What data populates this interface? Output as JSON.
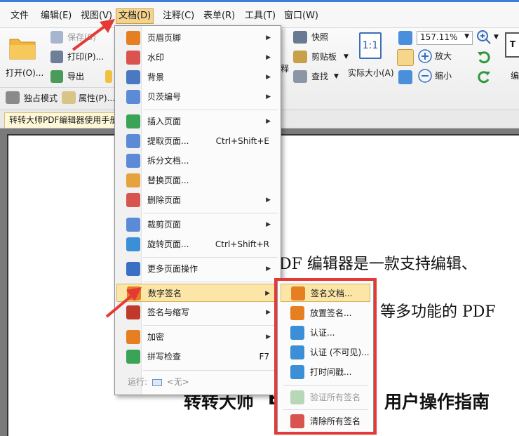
{
  "menubar": {
    "items": [
      {
        "label": "文件"
      },
      {
        "label": "编辑(E)"
      },
      {
        "label": "视图(V)"
      },
      {
        "label": "文档(D)"
      },
      {
        "label": "注释(C)"
      },
      {
        "label": "表单(R)"
      },
      {
        "label": "工具(T)"
      },
      {
        "label": "窗口(W)"
      }
    ]
  },
  "ribbon": {
    "open_label": "打开(O)...",
    "save_label": "保存(S)",
    "print_label": "打印(P)...",
    "export_label": "导出",
    "exclusive_mode_label": "独占模式",
    "properties_label": "属性(P)...",
    "partial_label": "释",
    "snapshot_label": "快照",
    "clipboard_label": "剪贴板",
    "find_label": "查找",
    "actual_size_label": "实际大小(A)",
    "zoom_value": "157.11%",
    "zoom_in_label": "放大",
    "zoom_out_label": "缩小",
    "edge_label": "编"
  },
  "tabs": {
    "document_tab": "转转大师PDF编辑器使用手册"
  },
  "document": {
    "line1": "DF 编辑器是一款支持编辑、",
    "line2": "等多功能的 PDF",
    "title": "转转大师",
    "title_mid": "E",
    "title_end": "用户操作指南"
  },
  "doc_menu": {
    "items": [
      {
        "label": "页眉页脚",
        "shortcut": "",
        "submenu": true,
        "color": "#e67e22"
      },
      {
        "label": "水印",
        "shortcut": "",
        "submenu": true,
        "color": "#d9534f"
      },
      {
        "label": "背景",
        "shortcut": "",
        "submenu": true,
        "color": "#4a78c2"
      },
      {
        "label": "贝茨编号",
        "shortcut": "",
        "submenu": true,
        "color": "#5b8bd6"
      },
      {
        "label": "插入页面",
        "shortcut": "",
        "submenu": true,
        "color": "#3aa356"
      },
      {
        "label": "提取页面...",
        "shortcut": "Ctrl+Shift+E",
        "submenu": false,
        "color": "#5b8bd6"
      },
      {
        "label": "拆分文档...",
        "shortcut": "",
        "submenu": false,
        "color": "#5b8bd6"
      },
      {
        "label": "替换页面...",
        "shortcut": "",
        "submenu": false,
        "color": "#e6a23c"
      },
      {
        "label": "删除页面",
        "shortcut": "",
        "submenu": true,
        "color": "#d9534f"
      },
      {
        "label": "裁剪页面",
        "shortcut": "",
        "submenu": true,
        "color": "#5b8bd6"
      },
      {
        "label": "旋转页面...",
        "shortcut": "Ctrl+Shift+R",
        "submenu": false,
        "color": "#3a8fd6"
      },
      {
        "label": "更多页面操作",
        "shortcut": "",
        "submenu": true,
        "color": "#3a6fc4"
      },
      {
        "label": "数字签名",
        "shortcut": "",
        "submenu": true,
        "color": "#e67e22"
      },
      {
        "label": "签名与缩写",
        "shortcut": "",
        "submenu": true,
        "color": "#c0392b"
      },
      {
        "label": "加密",
        "shortcut": "",
        "submenu": true,
        "color": "#e67e22"
      },
      {
        "label": "拼写检查",
        "shortcut": "F7",
        "submenu": false,
        "color": "#3aa356"
      }
    ],
    "run_label": "运行:",
    "run_value": "<无>"
  },
  "signature_submenu": {
    "items": [
      {
        "label": "签名文档...",
        "disabled": false,
        "color": "#e67e22"
      },
      {
        "label": "放置签名...",
        "disabled": false,
        "color": "#e67e22"
      },
      {
        "label": "认证...",
        "disabled": false,
        "color": "#3a8fd6"
      },
      {
        "label": "认证 (不可见)...",
        "disabled": false,
        "color": "#3a8fd6"
      },
      {
        "label": "打时间戳...",
        "disabled": false,
        "color": "#3a8fd6"
      },
      {
        "label": "验证所有签名",
        "disabled": true,
        "color": "#7fb77f"
      },
      {
        "label": "清除所有签名",
        "disabled": false,
        "color": "#d9534f"
      }
    ]
  },
  "colors": {
    "highlight": "#fbe6a8",
    "annotation_red": "#e53935",
    "accent_blue": "#3b7dd8"
  }
}
